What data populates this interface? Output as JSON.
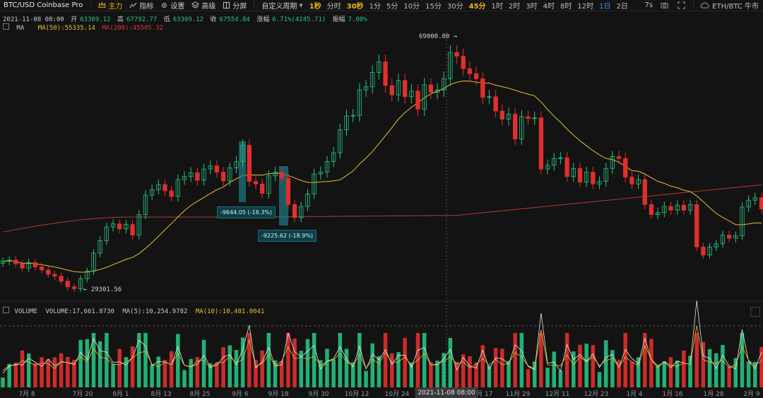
{
  "toolbar": {
    "symbol": "BTC/USD Coinbase Pro",
    "buttons": [
      {
        "label": "主力",
        "icon": "crown-icon",
        "active": true
      },
      {
        "label": "指标",
        "icon": "indicator-icon"
      },
      {
        "label": "设置",
        "icon": "gear-icon"
      },
      {
        "label": "高级",
        "icon": "layers-icon"
      },
      {
        "label": "分屏",
        "icon": "split-screen-icon"
      }
    ],
    "custom_period": "自定义周期",
    "intervals": [
      {
        "label": "1秒",
        "emph": true
      },
      {
        "label": "分时"
      },
      {
        "label": "30秒",
        "emph": true
      },
      {
        "label": "1分"
      },
      {
        "label": "5分"
      },
      {
        "label": "10分"
      },
      {
        "label": "15分"
      },
      {
        "label": "30分"
      },
      {
        "label": "45分",
        "emph": true
      },
      {
        "label": "1时"
      },
      {
        "label": "2时"
      },
      {
        "label": "3时"
      },
      {
        "label": "4时"
      },
      {
        "label": "8时"
      },
      {
        "label": "12时"
      },
      {
        "label": "1日",
        "selected": true
      },
      {
        "label": "2日"
      }
    ],
    "right": {
      "refresh": "7s",
      "ticker": "ETH/BTC 牛市"
    }
  },
  "ohlc": {
    "date": "2021-11-08 08:00",
    "open_label": "开",
    "open": "63309.12",
    "high_label": "高",
    "high": "67792.77",
    "low_label": "低",
    "low": "63309.12",
    "close_label": "收",
    "close": "67554.84",
    "change_label": "涨幅",
    "change": "6.71%(4245.71)",
    "amp_label": "振幅",
    "amplitude": "7.08%"
  },
  "ma_legend": {
    "name": "MA",
    "ma50": "MA(50):55335.14",
    "ma200": "MA(200):45505.32"
  },
  "volume_legend": {
    "name": "VOLUME",
    "volume": "VOLUME:17,661.8730",
    "ma5": "MA(5):10,254.9782",
    "ma10": "MA(10):10,481.0041"
  },
  "annotations": {
    "high_price": "69000.00",
    "low_price": "29301.56",
    "drop1": "-9644.05 (-18.3%)",
    "drop2": "-9225.62 (-18.9%)"
  },
  "xaxis": {
    "ticks": [
      "7月 8",
      "7月 20",
      "8月 1",
      "8月 13",
      "8月 25",
      "9月 6",
      "9月 18",
      "9月 30",
      "10月 12",
      "10月 24",
      "11月 17",
      "11月 29",
      "12月 11",
      "12月 23",
      "1月 4",
      "1月 16",
      "1月 28",
      "2月 9"
    ],
    "crosshair_label": "2021-11-08 08:00"
  },
  "colors": {
    "up": "#26c281",
    "down": "#e0302c",
    "ma50": "#e8c02a",
    "ma200": "#b73434",
    "bg": "#131313"
  },
  "chart_data": {
    "type": "candlestick",
    "series": [
      {
        "values": [
          34000,
          34200,
          33600,
          32900,
          33800,
          33100,
          32600,
          31900,
          31600,
          30800,
          29900,
          29600,
          31200,
          32400,
          35300,
          37300,
          39500,
          40000,
          39200,
          39900,
          38200,
          41500,
          44600,
          45500,
          46300,
          45300,
          44400,
          47100,
          47600,
          48200,
          47000,
          48800,
          49300,
          48300,
          46900,
          49000,
          50000,
          52600,
          46800,
          46400,
          44900,
          47700,
          48300,
          47300,
          43100,
          41000,
          42800,
          44800,
          48000,
          48300,
          50000,
          51400,
          55100,
          57300,
          57400,
          61500,
          62000,
          64300,
          66000,
          62200,
          60700,
          63000,
          60400,
          61300,
          58400,
          62300,
          61100,
          61500,
          63300,
          67500,
          66900,
          64900,
          64100,
          63300,
          60300,
          60400,
          58100,
          56800,
          57600,
          53600,
          57200,
          56900,
          57000,
          48800,
          49400,
          50500,
          50600,
          47600,
          48900,
          46700,
          48300,
          46400,
          46800,
          48900,
          50800,
          50500,
          47500,
          46400,
          47100,
          43100,
          41500,
          41800,
          42800,
          42200,
          43000,
          42200,
          43100,
          36300,
          35000,
          36300,
          36800,
          38200,
          37700,
          38100,
          42700,
          43800,
          44200,
          42400
        ]
      }
    ],
    "ylim": [
      29301.56,
      69000.0
    ]
  }
}
